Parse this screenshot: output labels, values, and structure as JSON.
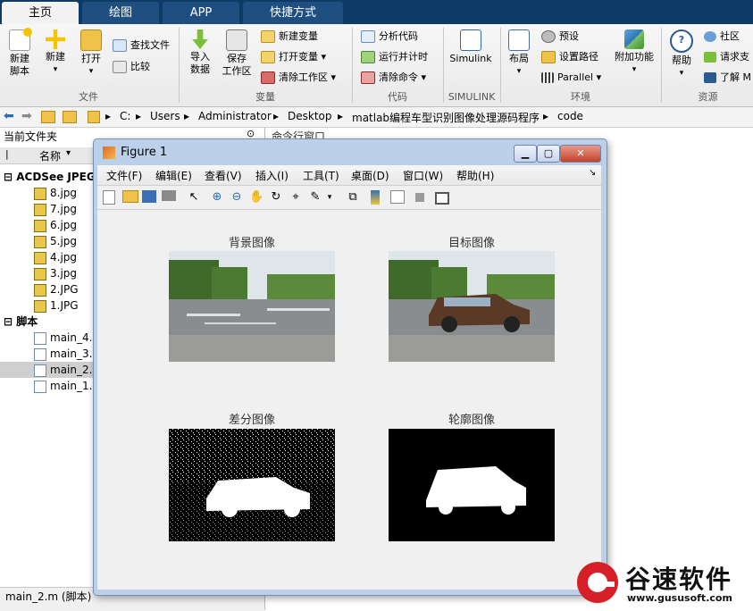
{
  "tabs": [
    "主页",
    "绘图",
    "APP",
    "快捷方式"
  ],
  "ribbon": {
    "file_group": {
      "label": "文件",
      "new_script": "新建\n脚本",
      "new": "新建",
      "open": "打开",
      "find_files": "查找文件",
      "compare": "比较"
    },
    "variable_group": {
      "label": "变量",
      "import": "导入\n数据",
      "save_ws": "保存\n工作区",
      "new_var": "新建变量",
      "open_var": "打开变量",
      "clear_ws": "清除工作区"
    },
    "code_group": {
      "label": "代码",
      "analyze": "分析代码",
      "run_time": "运行并计时",
      "clear_cmd": "清除命令"
    },
    "simulink_group": {
      "label": "SIMULINK",
      "simulink": "Simulink"
    },
    "env_group": {
      "label": "环境",
      "layout": "布局",
      "prefs": "预设",
      "set_path": "设置路径",
      "parallel": "Parallel",
      "addons": "附加功能"
    },
    "resources_group": {
      "label": "资源",
      "help": "帮助",
      "community": "社区",
      "request": "请求支",
      "learn": "了解 M"
    }
  },
  "address": {
    "crumbs": [
      "C:",
      "Users",
      "Administrator",
      "Desktop",
      "matlab编程车型识别图像处理源码程序",
      "code"
    ]
  },
  "left_panel": {
    "title": "当前文件夹",
    "column": "名称",
    "groups": [
      {
        "label": "ACDSee JPEG",
        "items": [
          "8.jpg",
          "7.jpg",
          "6.jpg",
          "5.jpg",
          "4.jpg",
          "3.jpg",
          "2.JPG",
          "1.JPG"
        ]
      },
      {
        "label": "脚本",
        "items": [
          "main_4.m",
          "main_3.m",
          "main_2.m",
          "main_1.m"
        ]
      }
    ],
    "status": "main_2.m  (脚本)"
  },
  "right_panel": {
    "title": "命令行窗口"
  },
  "figure": {
    "title": "Figure 1",
    "menu": [
      "文件(F)",
      "编辑(E)",
      "查看(V)",
      "插入(I)",
      "工具(T)",
      "桌面(D)",
      "窗口(W)",
      "帮助(H)"
    ],
    "panels": [
      "背景图像",
      "目标图像",
      "差分图像",
      "轮廓图像"
    ]
  },
  "watermark": {
    "brand": "谷速软件",
    "url": "www.gususoft.com"
  }
}
